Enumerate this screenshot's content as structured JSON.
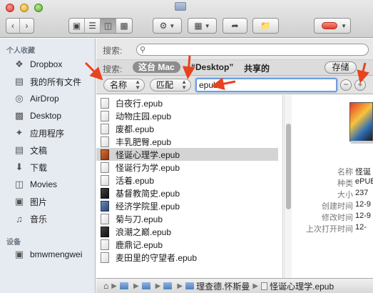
{
  "toolbar": {
    "back_icon": "chevron-left",
    "forward_icon": "chevron-right",
    "view_modes": [
      "icon-view",
      "list-view",
      "column-view",
      "coverflow-view"
    ],
    "action_icon": "gear",
    "arrange_icon": "grid",
    "share_icon": "share",
    "new_folder_icon": "folder",
    "tag_color": "#e0402f"
  },
  "sidebar": {
    "favorites_header": "个人收藏",
    "favorites": [
      {
        "label": "Dropbox",
        "icon": "dropbox-icon"
      },
      {
        "label": "我的所有文件",
        "icon": "all-files-icon"
      },
      {
        "label": "AirDrop",
        "icon": "airdrop-icon"
      },
      {
        "label": "Desktop",
        "icon": "desktop-icon"
      },
      {
        "label": "应用程序",
        "icon": "applications-icon"
      },
      {
        "label": "文稿",
        "icon": "documents-icon"
      },
      {
        "label": "下载",
        "icon": "downloads-icon"
      },
      {
        "label": "Movies",
        "icon": "movies-icon"
      },
      {
        "label": "图片",
        "icon": "pictures-icon"
      },
      {
        "label": "音乐",
        "icon": "music-icon"
      }
    ],
    "devices_header": "设备",
    "devices": [
      {
        "label": "bmwmengwei",
        "icon": "computer-icon"
      }
    ]
  },
  "search": {
    "row1_label": "搜索:",
    "row2_label": "搜索:",
    "scope_mac": "这台 Mac",
    "scope_desktop": "“Desktop”",
    "scope_shared": "共享的",
    "save_label": "存储",
    "attribute_popup": "名称",
    "operator_popup": "匹配",
    "criteria_value": "epub",
    "remove_label": "−",
    "add_label": "+"
  },
  "files": [
    {
      "name": "白夜行.epub",
      "style": "plain"
    },
    {
      "name": "动物庄园.epub",
      "style": "plain"
    },
    {
      "name": "废都.epub",
      "style": "plain"
    },
    {
      "name": "丰乳肥臀.epub",
      "style": "plain"
    },
    {
      "name": "怪诞心理学.epub",
      "style": "colored",
      "selected": true
    },
    {
      "name": "怪诞行为学.epub",
      "style": "plain"
    },
    {
      "name": "活着.epub",
      "style": "plain"
    },
    {
      "name": "基督教简史.epub",
      "style": "dark"
    },
    {
      "name": "经济学院里.epub",
      "style": "blue"
    },
    {
      "name": "菊与刀.epub",
      "style": "plain"
    },
    {
      "name": "浪潮之巅.epub",
      "style": "dark"
    },
    {
      "name": "鹿鼎记.epub",
      "style": "plain"
    },
    {
      "name": "麦田里的守望者.epub",
      "style": "plain"
    }
  ],
  "preview": {
    "meta": [
      {
        "label": "名称",
        "value": "怪诞"
      },
      {
        "label": "种类",
        "value": "ePUB"
      },
      {
        "label": "大小",
        "value": "237"
      },
      {
        "label": "创建时间",
        "value": "12-9"
      },
      {
        "label": "修改时间",
        "value": "12-9"
      },
      {
        "label": "上次打开时间",
        "value": "12-"
      }
    ]
  },
  "pathbar": {
    "home_icon": "home-icon",
    "crumbs": [
      "",
      "",
      "",
      "理查德.怀斯曼",
      "怪诞心理学.epub"
    ]
  }
}
